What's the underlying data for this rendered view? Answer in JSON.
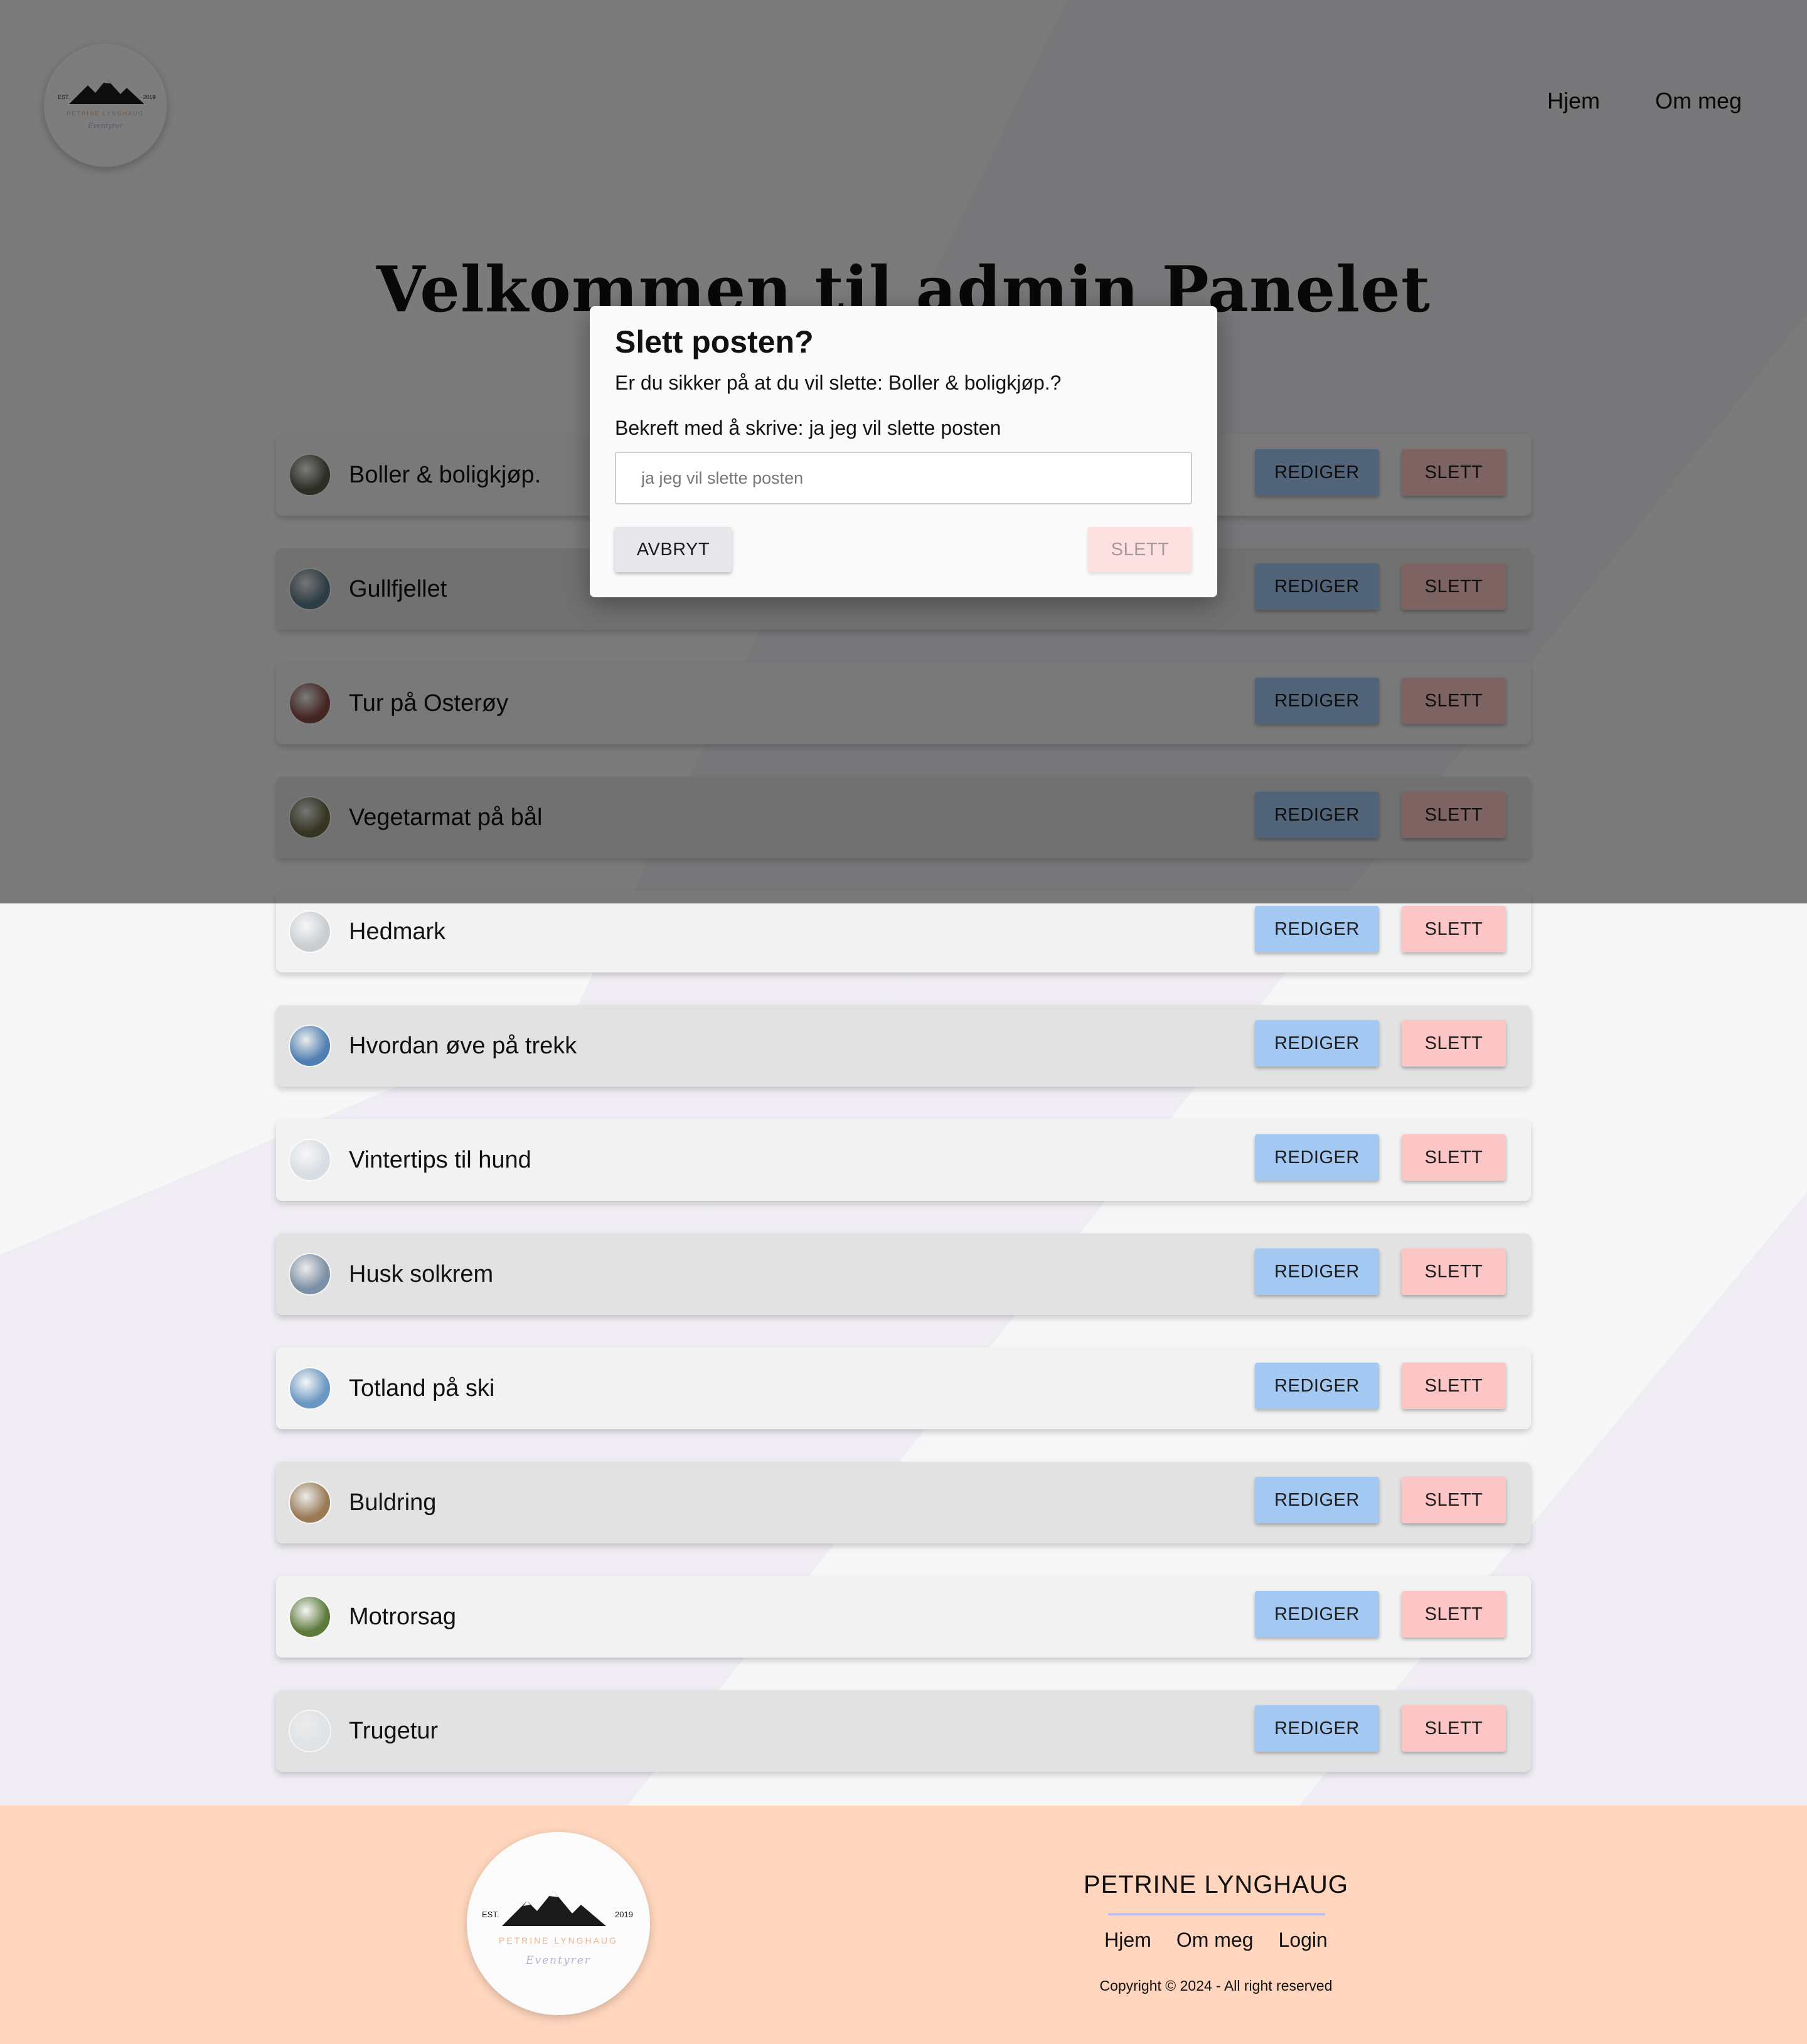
{
  "header": {
    "logo_est": "EST.",
    "logo_year": "2019",
    "logo_name": "PETRINE LYNGHAUG",
    "logo_tagline": "Eventyrer",
    "nav": [
      "Hjem",
      "Om meg"
    ]
  },
  "page_title": "Velkommen til admin Panelet",
  "row_actions": {
    "edit_label": "REDIGER",
    "delete_label": "SLETT"
  },
  "posts": [
    {
      "title": "Boller & boligkjøp.",
      "avatar_color": "#5b5a4c"
    },
    {
      "title": "Gullfjellet",
      "avatar_color": "#5a7a8a"
    },
    {
      "title": "Tur på Osterøy",
      "avatar_color": "#8a4a45"
    },
    {
      "title": "Vegetarmat på bål",
      "avatar_color": "#6b6a45"
    },
    {
      "title": "Hedmark",
      "avatar_color": "#c9cdd1"
    },
    {
      "title": "Hvordan øve på trekk",
      "avatar_color": "#4f7fb3"
    },
    {
      "title": "Vintertips til hund",
      "avatar_color": "#d8dde3"
    },
    {
      "title": "Husk solkrem",
      "avatar_color": "#7b8fa5"
    },
    {
      "title": "Totland på ski",
      "avatar_color": "#6a96c2"
    },
    {
      "title": "Buldring",
      "avatar_color": "#9a7a55"
    },
    {
      "title": "Motrorsag",
      "avatar_color": "#5c7a3a"
    },
    {
      "title": "Trugetur",
      "avatar_color": "#dfe3e6"
    }
  ],
  "modal": {
    "title": "Slett posten?",
    "question": "Er du sikker på at du vil slette: Boller & boligkjøp.?",
    "confirm_label": "Bekreft med å skrive: ja jeg vil slette posten",
    "input_placeholder": "ja jeg vil slette posten",
    "input_value": "",
    "cancel_label": "AVBRYT",
    "delete_label": "SLETT"
  },
  "footer": {
    "brand": "PETRINE LYNGHAUG",
    "links": [
      "Hjem",
      "Om meg",
      "Login"
    ],
    "copyright": "Copyright © 2024 - All right reserved"
  },
  "colors": {
    "edit_button": "#a3c8f2",
    "delete_button": "#fdc6c6",
    "footer_bg": "#ffd6bd",
    "bg_stripe": "#efedf3"
  }
}
